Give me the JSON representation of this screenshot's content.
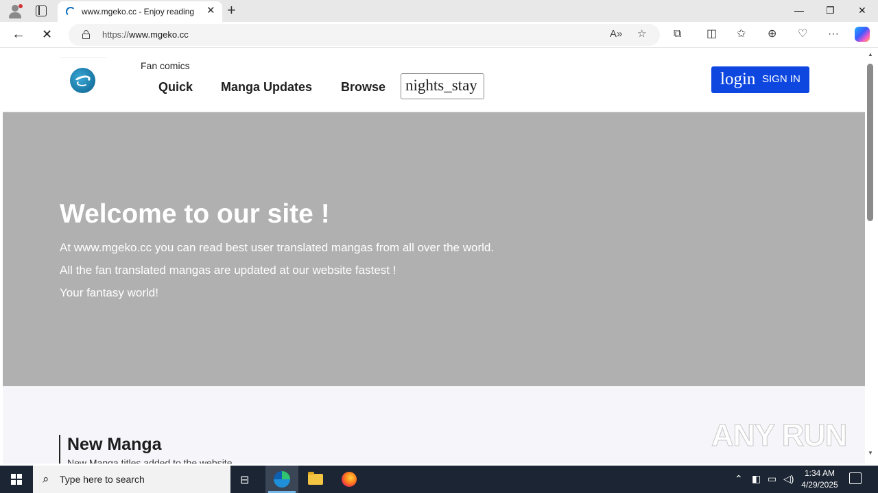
{
  "browser": {
    "tab_title": "www.mgeko.cc - Enjoy reading",
    "tab_close": "✕",
    "new_tab": "+",
    "url_prefix": "https://",
    "url_host": "www.mgeko.cc",
    "window_controls": {
      "minimize": "—",
      "restore": "❐",
      "close": "✕"
    },
    "icons": [
      "read-aloud-icon",
      "favorite-star-icon",
      "extensions-icon",
      "split-screen-icon",
      "favorites-icon",
      "collections-icon",
      "browser-essentials-icon",
      "more-icon",
      "copilot-icon"
    ]
  },
  "site": {
    "tagline": "Fan comics",
    "nav": [
      {
        "label": "Quick"
      },
      {
        "label": "Manga Updates"
      },
      {
        "label": "Browse"
      }
    ],
    "search_value": "nights_stay",
    "login": {
      "big": "login",
      "small": "SIGN IN"
    }
  },
  "hero": {
    "title": "Welcome to our site !",
    "lines": [
      "At www.mgeko.cc you can read best user translated mangas from all over the world.",
      "All the fan translated mangas are updated at our website fastest !",
      "Your fantasy world!"
    ],
    "background": "#b0b0b0"
  },
  "section": {
    "title": "New Manga",
    "subtitle": "New Manga titles added to the website"
  },
  "watermark": "ANY RUN",
  "taskbar": {
    "search_placeholder": "Type here to search",
    "time": "1:34 AM",
    "date": "4/29/2025"
  }
}
